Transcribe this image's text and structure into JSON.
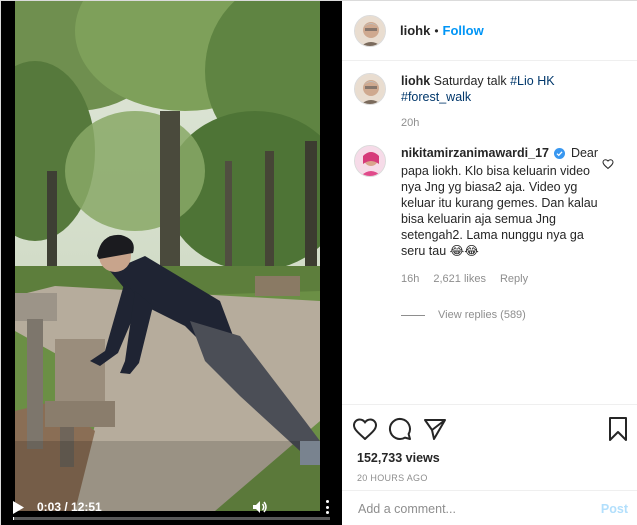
{
  "video": {
    "current_time": "0:03",
    "duration": "12:51",
    "time_display": "0:03 / 12:51",
    "progress": 0.004
  },
  "post": {
    "username": "liohk",
    "separator": "•",
    "follow_label": "Follow"
  },
  "caption": {
    "username": "liohk",
    "text": "Saturday talk",
    "tags": [
      "#Lio HK",
      "#forest_walk"
    ],
    "age": "20h"
  },
  "comment": {
    "username": "nikitamirzanimawardi_17",
    "verified": true,
    "text": "Dear papa liokh. Klo bisa keluarin video nya Jng yg biasa2 aja. Video yg keluar itu kurang gemes. Dan kalau bisa keluarin aja semua Jng setengah2. Lama nunggu nya ga seru tau",
    "emoji": "😂😂",
    "age": "16h",
    "likes": "2,621 likes",
    "reply_label": "Reply",
    "view_replies": "View replies (589)"
  },
  "stats": {
    "views": "152,733 views",
    "posted": "20 HOURS AGO"
  },
  "composer": {
    "placeholder": "Add a comment...",
    "post_label": "Post"
  },
  "colors": {
    "accent": "#0095f6",
    "tag": "#00376b",
    "muted": "#8e8e8e",
    "verified": "#3897f0"
  },
  "icons": {
    "like": "heart-icon",
    "comment": "comment-icon",
    "share": "paper-plane-icon",
    "save": "bookmark-icon",
    "play": "play-icon",
    "volume": "volume-icon",
    "more": "more-vertical-icon"
  }
}
